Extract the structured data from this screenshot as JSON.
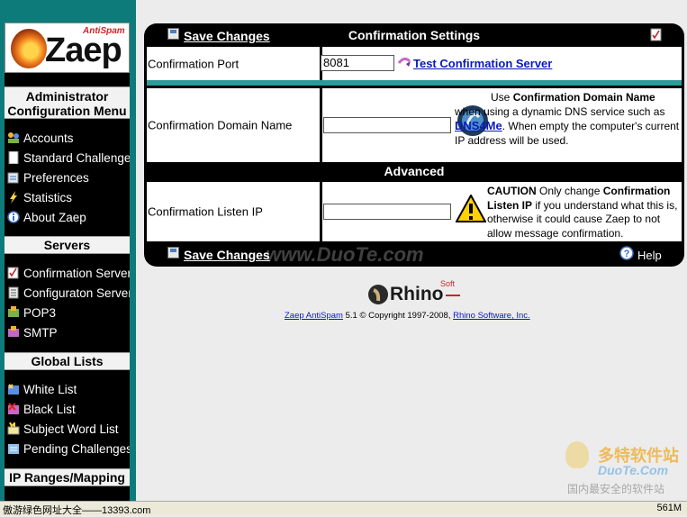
{
  "sidebar": {
    "logo_word": "Zaep",
    "logo_tag": "AntiSpam",
    "sections": [
      {
        "title": "Administrator Configuration Menu",
        "items": [
          "Accounts",
          "Standard Challenge",
          "Preferences",
          "Statistics",
          "About Zaep"
        ]
      },
      {
        "title": "Servers",
        "items": [
          "Confirmation Server",
          "Configuraton Server",
          "POP3",
          "SMTP"
        ]
      },
      {
        "title": "Global Lists",
        "items": [
          "White List",
          "Black List",
          "Subject Word List",
          "Pending Challenges"
        ]
      },
      {
        "title": "IP Ranges/Mapping",
        "items": []
      }
    ]
  },
  "panel": {
    "title": "Confirmation Settings",
    "save_label": "Save Changes",
    "help_label": "Help",
    "port": {
      "label": "Confirmation Port",
      "value": "8081",
      "test_link": "Test Confirmation Server"
    },
    "domain": {
      "label": "Confirmation Domain Name",
      "value": "",
      "help_1": "Use ",
      "help_bold": "Confirmation Domain Name",
      "help_2": " when using a dynamic DNS service such as ",
      "help_link": "DNS4Me",
      "help_3": ". When empty the computer's current IP address will be used."
    },
    "advanced_label": "Advanced",
    "listen": {
      "label": "Confirmation Listen IP",
      "value": "",
      "caution_bold": "CAUTION",
      "caution_1": " Only change ",
      "caution_bold2": "Confirmation Listen IP",
      "caution_2": " if you understand what this is, otherwise it could cause Zaep to not allow message confirmation."
    }
  },
  "footer": {
    "brand": "Rhino",
    "brand_soft": "Soft",
    "product_link": "Zaep AntiSpam",
    "copyright": "5.1 © Copyright 1997-2008,",
    "company_link": "Rhino Software, Inc."
  },
  "watermark": {
    "text": "www.DuoTe.com",
    "badge_top": "多特软件站",
    "badge_mid": "DuoTe.Com",
    "badge_bottom": "国内最安全的软件站"
  },
  "statusbar": {
    "text": "傲游绿色网址大全——13393.com",
    "memory": "561M"
  }
}
